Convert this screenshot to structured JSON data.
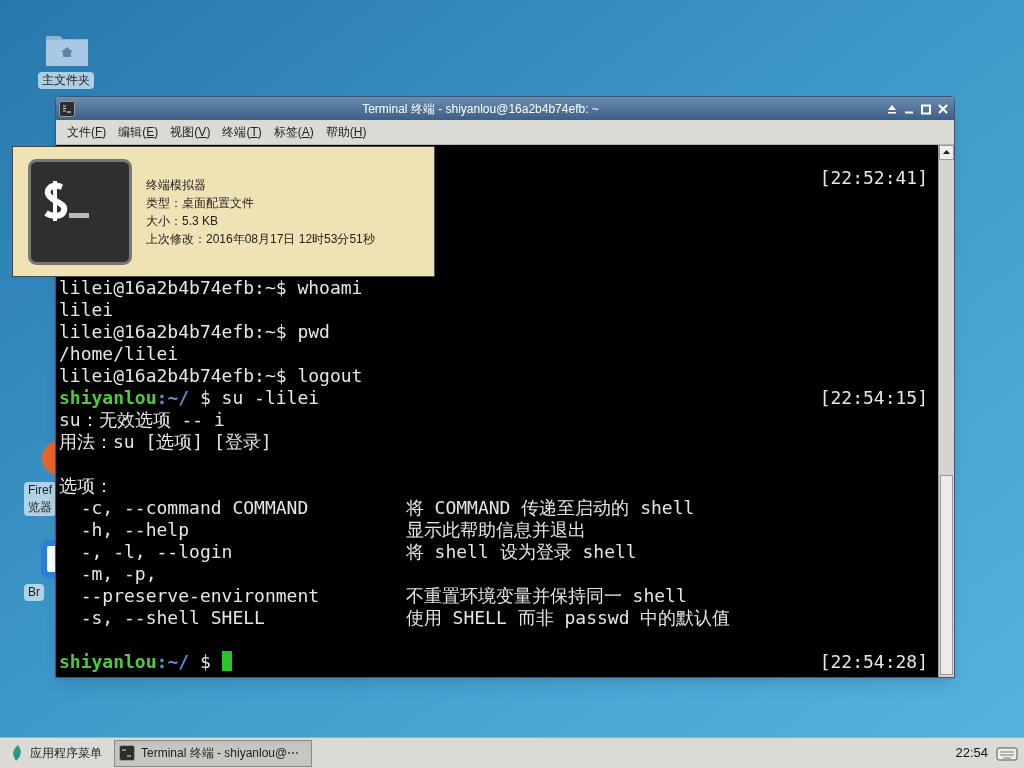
{
  "desktop_icons": [
    {
      "kind": "folder",
      "label": [
        "主文件夹"
      ]
    },
    {
      "kind": "browser",
      "label": [
        "Firef",
        "览器"
      ]
    },
    {
      "kind": "app",
      "label": [
        "Br"
      ]
    }
  ],
  "window": {
    "title": "Terminal 终端 - shiyanlou@16a2b4b74efb: ~",
    "menu": [
      {
        "label": "文件(",
        "key": "F",
        "close": ")"
      },
      {
        "label": "编辑(",
        "key": "E",
        "close": ")"
      },
      {
        "label": "视图(",
        "key": "V",
        "close": ")"
      },
      {
        "label": "终端(",
        "key": "T",
        "close": ")"
      },
      {
        "label": "标签(",
        "key": "A",
        "close": ")"
      },
      {
        "label": "帮助(",
        "key": "H",
        "close": ")"
      }
    ]
  },
  "terminal": {
    "lines": [
      {
        "kind": "blank",
        "timestamp": "[22:52:41]"
      },
      {
        "kind": "blank"
      },
      {
        "kind": "blank"
      },
      {
        "kind": "blank"
      },
      {
        "kind": "blank"
      },
      {
        "kind": "text",
        "text": "lilei@16a2b4b74efb:~$ whoami"
      },
      {
        "kind": "text",
        "text": "lilei"
      },
      {
        "kind": "text",
        "text": "lilei@16a2b4b74efb:~$ pwd"
      },
      {
        "kind": "text",
        "text": "/home/lilei"
      },
      {
        "kind": "text",
        "text": "lilei@16a2b4b74efb:~$ logout"
      },
      {
        "kind": "prompt",
        "user": "shiyanlou",
        "path": ":~/",
        "sign": "$",
        "command": "su -lilei",
        "timestamp": "[22:54:15]"
      },
      {
        "kind": "text",
        "text": "su：无效选项 -- i"
      },
      {
        "kind": "text",
        "text": "用法：su [选项] [登录]"
      },
      {
        "kind": "blank"
      },
      {
        "kind": "text",
        "text": "选项："
      },
      {
        "kind": "option",
        "flag": "-c, --command COMMAND",
        "description": "将 COMMAND 传递至启动的 shell"
      },
      {
        "kind": "option",
        "flag": "-h, --help",
        "description": "显示此帮助信息并退出"
      },
      {
        "kind": "option",
        "flag": "-, -l, --login",
        "description": "将 shell 设为登录 shell"
      },
      {
        "kind": "option",
        "flag": "-m, -p,"
      },
      {
        "kind": "option",
        "flag": "--preserve-environment",
        "description": "不重置环境变量并保持同一 shell"
      },
      {
        "kind": "option",
        "flag": "-s, --shell SHELL",
        "description": "使用 SHELL 而非 passwd 中的默认值"
      },
      {
        "kind": "blank"
      },
      {
        "kind": "prompt",
        "user": "shiyanlou",
        "path": ":~/",
        "sign": "$",
        "cursor": true,
        "timestamp": "[22:54:28]"
      }
    ]
  },
  "tooltip": {
    "title": "终端模拟器",
    "lines": [
      "类型：桌面配置文件",
      "大小：5.3 KB",
      "上次修改：2016年08月17日 12时53分51秒"
    ]
  },
  "taskbar": {
    "app_menu": "应用程序菜单",
    "tasks": [
      {
        "label": "Terminal 终端 - shiyanlou@⋯",
        "selected": true
      }
    ],
    "clock": "22:54"
  }
}
